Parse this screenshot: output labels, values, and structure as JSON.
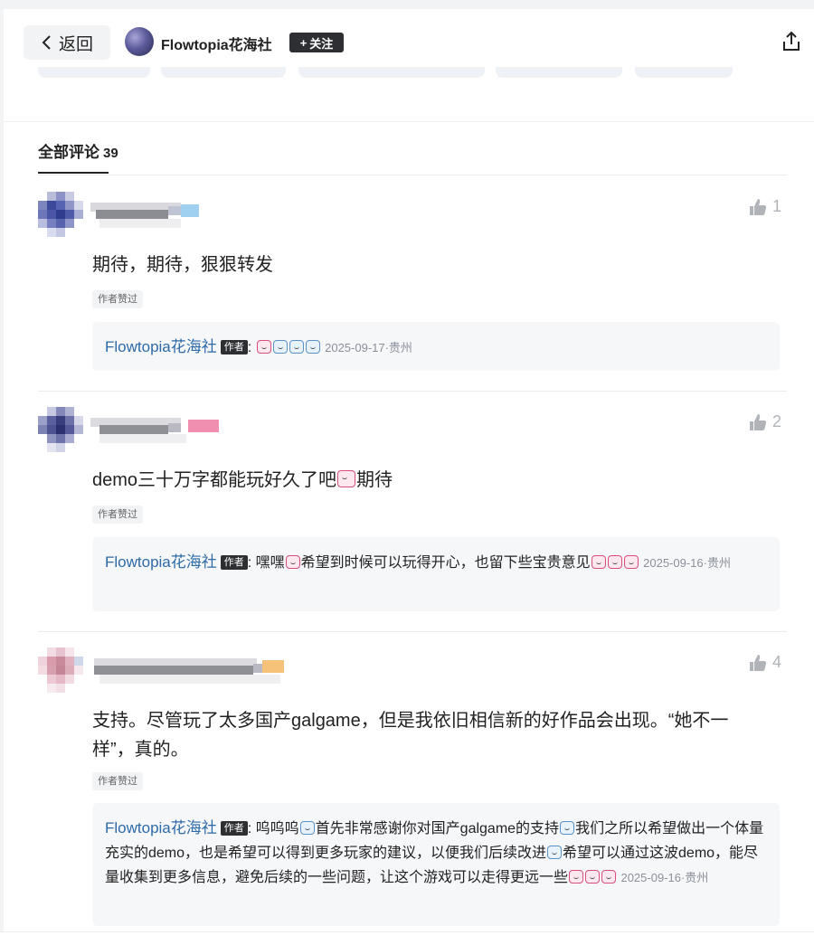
{
  "header": {
    "back_label": "返回",
    "author_name": "Flowtopia花海社",
    "follow_label": "关注"
  },
  "tab": {
    "label": "全部评论",
    "count": "39"
  },
  "comments": [
    {
      "likes": "1",
      "text": "期待，期待，狠狠转发",
      "liked_tag": "作者赞过",
      "reply": {
        "name": "Flowtopia花海社",
        "badge": "作者",
        "text": "",
        "meta": "2025-09-17·贵州"
      }
    },
    {
      "likes": "2",
      "text": "demo三十万字都能玩好久了吧",
      "text_tail": "期待",
      "liked_tag": "作者赞过",
      "reply": {
        "name": "Flowtopia花海社",
        "badge": "作者",
        "text_a": "嘿嘿",
        "text_b": "希望到时候可以玩得开心，也留下些宝贵意见",
        "meta": "2025-09-16·贵州"
      }
    },
    {
      "likes": "4",
      "text": "支持。尽管玩了太多国产galgame，但是我依旧相信新的好作品会出现。“她不一样”，真的。",
      "liked_tag": "作者赞过",
      "reply": {
        "name": "Flowtopia花海社",
        "badge": "作者",
        "text_a": "呜呜呜",
        "text_b": "首先非常感谢你对国产galgame的支持",
        "text_c": "我们之所以希望做出一个体量充实的demo，也是希望可以得到更多玩家的建议，以便我们后续改进",
        "text_d": "希望可以通过这波demo，能尽量收集到更多信息，避免后续的一些问题，让这个游戏可以走得更远一些",
        "meta": "2025-09-16·贵州"
      }
    }
  ],
  "icons": {
    "back": "chevron-left-icon",
    "share": "share-icon",
    "like": "thumbs-up-icon",
    "emoji": "emoji-sticker-icon"
  },
  "colors": {
    "reply_name": "#2d6aa8",
    "badge_bg": "#2d2f33",
    "reply_bg": "#f6f7f9"
  }
}
